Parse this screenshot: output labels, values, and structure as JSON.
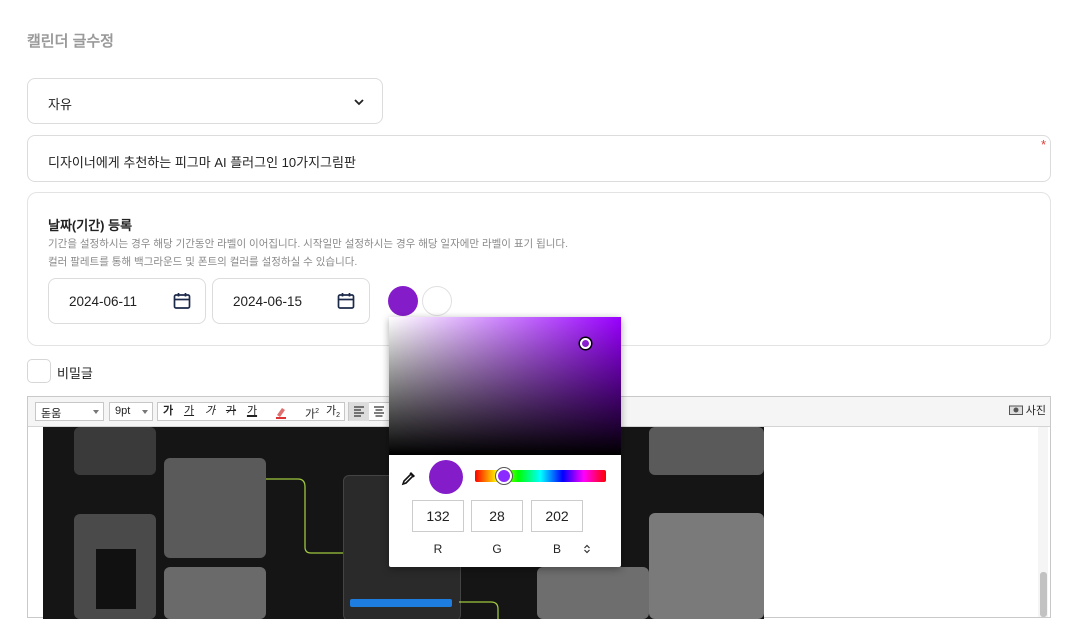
{
  "page_title": "캘린더 글수정",
  "category": {
    "value": "자유"
  },
  "title_field": {
    "value": "디자이너에게 추천하는 피그마 AI 플러그인 10가지그림판",
    "required_mark": "*"
  },
  "date_section": {
    "title": "날짜(기간) 등록",
    "desc1": "기간을 설정하시는 경우 해당 기간동안 라벨이 이어집니다. 시작일만 설정하시는 경우 해당 일자에만 라벨이 표기 됩니다.",
    "desc2": "컬러 팔레트를 통해 백그라운드 및 폰트의 컬러를 설정하실 수 있습니다.",
    "start_date": "2024-06-11",
    "end_date": "2024-06-15",
    "bg_color": "#841cca",
    "font_color": "#ffffff"
  },
  "secret": {
    "label": "비밀글",
    "checked": false
  },
  "editor": {
    "font_family": "돋움",
    "font_size": "9pt",
    "btn_bold": "가",
    "btn_underline": "가",
    "btn_italic": "가",
    "btn_strike": "가",
    "btn_fontcolor": "가",
    "btn_superscript": "가",
    "btn_subscript": "가",
    "photo_label": "사진"
  },
  "color_picker": {
    "r": "132",
    "g": "28",
    "b": "202",
    "label_r": "R",
    "label_g": "G",
    "label_b": "B",
    "hue_color": "#9900ff"
  }
}
